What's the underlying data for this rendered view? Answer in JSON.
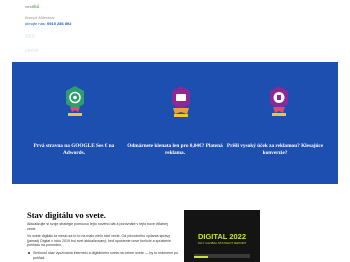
{
  "header": {
    "logo_prefix": "mes",
    "logo_name": "ská",
    "subtitle": "Bartsík Milestnal",
    "phone_label": "obrujte nás:",
    "phone_number": "0910 286 892",
    "menu_item_1": "SKÁ",
    "menu_item_2": "portok"
  },
  "hero": {
    "background_color": "#1d4fb0",
    "cards": [
      {
        "icon": "google-ads-badge-icon",
        "badge_color": "#2e9e6f",
        "text": "Prvá stravna na GOOGLE Ses € na Adwords."
      },
      {
        "icon": "social-media-badge-icon",
        "badge_color": "#8a2a93",
        "text": "Odmárnete klenata len pro 0,04€? Platená reklama."
      },
      {
        "icon": "analytics-badge-icon",
        "badge_color": "#8a2a93",
        "text": "Prišli vysoký úček za reklamou? Klesajúce konverzie?"
      }
    ]
  },
  "section": {
    "title": "Stav digitálu vo svete.",
    "paragraph_1": "Aktualizujte si svoje stratégie pomocou tejto nového dát a porovnáte v tejto nove vlilatnej vecie.",
    "paragraph_2": "Vo svete digitálu ta nieslo sa to to na malo nieľo stať večie. Od pôvodného vydania správy (jamad) Digital v roku 2019 bol svet aktualizovaný, keď spustenie nové funkcie a spustenie pohľadu na pomoden.",
    "list_item": "Smilnosť stav využívania internetu a digitálneho sveta na celom svete — by to mannemi po pohľad."
  },
  "promo": {
    "title": "DIGITAL 2022",
    "subtitle": "JULY GLOBAL STATSHOT REPORT",
    "accent_color": "#c6e33a"
  }
}
